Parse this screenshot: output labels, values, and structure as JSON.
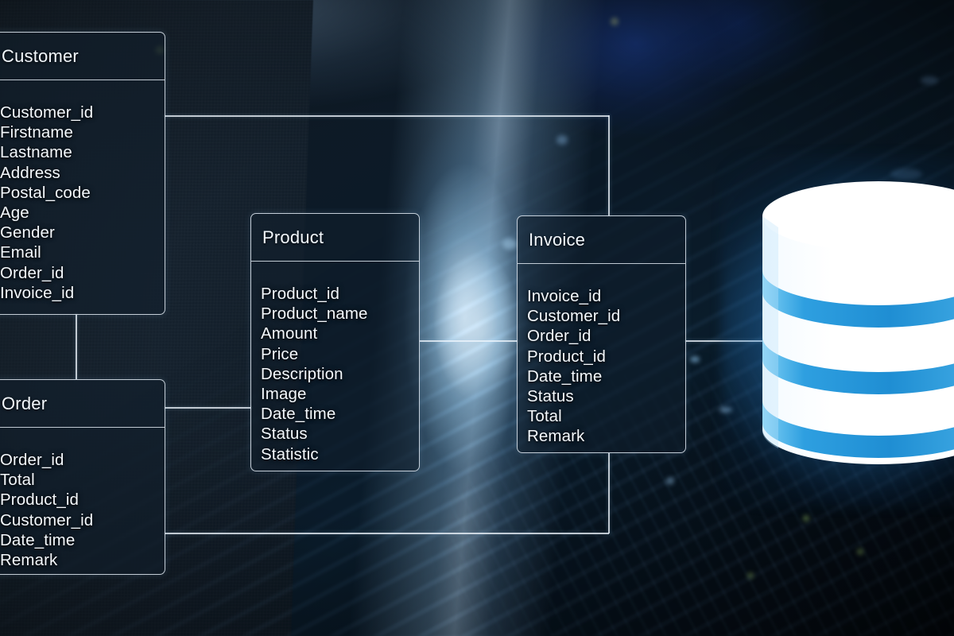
{
  "scene": {
    "kind": "er-diagram-overlay-on-server-room-photo",
    "background_description": "Blurred photograph of a data-center server rack with blue cabling and a bright light flare",
    "accent_color": "#2e9fe0",
    "line_color": "#eef5fc",
    "text_color": "#f4f8fc",
    "panel_fill": "#101e2c"
  },
  "diagram": {
    "tables": [
      {
        "name": "Customer",
        "title": "Customer",
        "fields": [
          "Customer_id",
          "Firstname",
          "Lastname",
          "Address",
          "Postal_code",
          "Age",
          "Gender",
          "Email",
          "Order_id",
          "Invoice_id"
        ]
      },
      {
        "name": "Order",
        "title": "Order",
        "fields": [
          "Order_id",
          "Total",
          "Product_id",
          "Customer_id",
          "Date_time",
          "Remark"
        ]
      },
      {
        "name": "Product",
        "title": "Product",
        "fields": [
          "Product_id",
          "Product_name",
          "Amount",
          "Price",
          "Description",
          "Image",
          "Date_time",
          "Status",
          "Statistic"
        ]
      },
      {
        "name": "Invoice",
        "title": "Invoice",
        "fields": [
          "Invoice_id",
          "Customer_id",
          "Order_id",
          "Product_id",
          "Date_time",
          "Status",
          "Total",
          "Remark"
        ]
      }
    ],
    "relationships": [
      {
        "from": "Customer",
        "to": "Invoice",
        "label": "customer-to-invoice"
      },
      {
        "from": "Customer",
        "to": "Order",
        "label": "customer-to-order"
      },
      {
        "from": "Order",
        "to": "Product",
        "label": "order-to-product"
      },
      {
        "from": "Order",
        "to": "Invoice",
        "label": "order-to-invoice"
      },
      {
        "from": "Product",
        "to": "Invoice",
        "label": "product-to-invoice"
      },
      {
        "from": "Invoice",
        "to": "Database",
        "label": "invoice-to-database"
      }
    ],
    "database_icon": {
      "name": "database-cylinder-icon",
      "band_count": 3,
      "body_color": "#ffffff",
      "band_color": "#2e9fe0"
    }
  }
}
